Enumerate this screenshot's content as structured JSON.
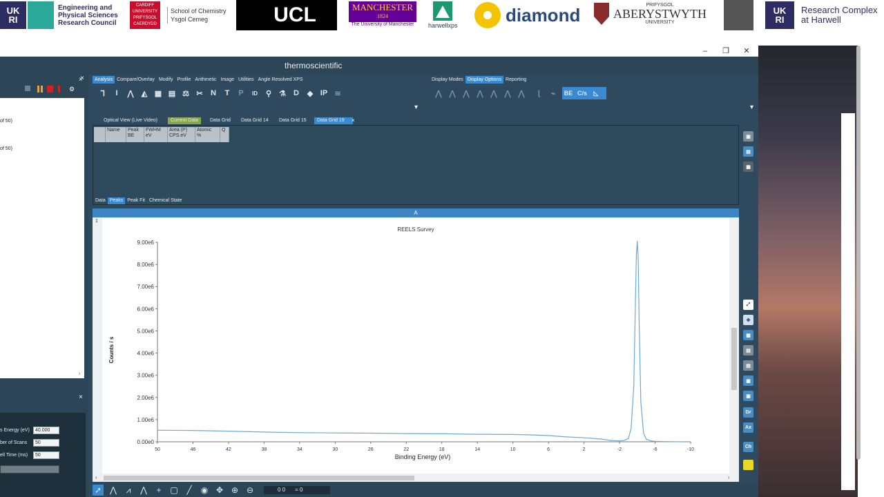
{
  "logos": {
    "ukri": {
      "mark": "UK\nRI",
      "text_lines": [
        "Engineering and",
        "Physical Sciences",
        "Research Council"
      ]
    },
    "cardiff": {
      "mark_lines": [
        "CARDIFF",
        "UNIVERSITY",
        "PRIFYSGOL",
        "CAERDYDD"
      ],
      "text_lines": [
        "School of Chemistry",
        "Ysgol Cemeg"
      ]
    },
    "ucl": {
      "text": "UCL"
    },
    "manchester": {
      "text": "MANCHESTER",
      "year": "1824",
      "sub": "The University of Manchester"
    },
    "harwellxps": {
      "text": "harwellxps"
    },
    "diamond": {
      "text": "diamond"
    },
    "aberystwyth": {
      "top": "PRIFYSGOL",
      "text": "ABERYSTWYTH",
      "sub": "UNIVERSITY"
    },
    "research_complex": {
      "mark": "UK\nRI",
      "text_lines": [
        "Research Complex",
        "at Harwell"
      ]
    }
  },
  "window": {
    "brand": "thermoscientific",
    "minimize": "–",
    "maximize": "❐",
    "close": "✕"
  },
  "ribbon": {
    "tabs": [
      "Analysis",
      "Compare/Overlay",
      "Modify",
      "Profile",
      "Arithmetic",
      "Image",
      "Utilities",
      "Angle Resolved XPS"
    ],
    "right_tabs": [
      "Display Modes",
      "Display Options",
      "Reporting"
    ],
    "icons": [
      "ID",
      "D",
      "IP"
    ],
    "toggles": [
      "BE",
      "C/s"
    ]
  },
  "left_panel": {
    "items": [
      "of 50)",
      "of 50)"
    ],
    "fields": [
      {
        "label": "s Energy (eV)",
        "value": "40.000"
      },
      {
        "label": "ber of Scans",
        "value": "50"
      },
      {
        "label": "ell Time  (ms)",
        "value": "50"
      }
    ]
  },
  "doc_tabs": [
    "Optical View (Live Video)",
    "Current Data",
    "Data Grid",
    "Data Grid 14",
    "Data Grid 15",
    "Data Grid 19"
  ],
  "grid": {
    "columns": [
      {
        "l1": "",
        "l2": ""
      },
      {
        "l1": "Name",
        "l2": ""
      },
      {
        "l1": "Peak",
        "l2": "BE"
      },
      {
        "l1": "FWHM",
        "l2": "eV"
      },
      {
        "l1": "Area (P)",
        "l2": "CPS.eV"
      },
      {
        "l1": "Atomic",
        "l2": "%"
      },
      {
        "l1": "Q",
        "l2": ""
      }
    ],
    "bottom_tabs": [
      "Data",
      "Peaks",
      "Peak Fit",
      "Chemical State"
    ]
  },
  "chart_panel": {
    "header": "A",
    "side_label": "1"
  },
  "chart_data": {
    "type": "line",
    "title": "REELS Survey",
    "xlabel": "Binding Energy (eV)",
    "ylabel": "Counts / s",
    "xlim": [
      50,
      -10
    ],
    "ylim": [
      0,
      9000000
    ],
    "x_ticks": [
      50,
      46,
      42,
      38,
      34,
      30,
      26,
      22,
      18,
      14,
      10,
      6,
      2,
      -2,
      -6,
      -10
    ],
    "x_tick_labels": [
      "50",
      "46",
      "42",
      "38",
      "34",
      "30",
      "26",
      "22",
      "18",
      "14",
      "10",
      "6",
      "2",
      "-2",
      "-6",
      "-10"
    ],
    "y_ticks": [
      0,
      1000000,
      2000000,
      3000000,
      4000000,
      5000000,
      6000000,
      7000000,
      8000000,
      9000000
    ],
    "y_tick_labels": [
      "0.00e0",
      "1.00e6",
      "2.00e6",
      "3.00e6",
      "4.00e6",
      "5.00e6",
      "6.00e6",
      "7.00e6",
      "8.00e6",
      "9.00e6"
    ],
    "series": [
      {
        "color": "#6aa8d8",
        "x": [
          50,
          46,
          42,
          38,
          34,
          30,
          26,
          22,
          18,
          14,
          10,
          8,
          6,
          4,
          2,
          0,
          -1,
          -2,
          -2.5,
          -3,
          -3.3,
          -3.6,
          -3.8,
          -3.9,
          -4,
          -4.1,
          -4.2,
          -4.4,
          -4.7,
          -5,
          -5.5,
          -6,
          -7,
          -8,
          -9
        ],
        "values": [
          520000,
          510000,
          480000,
          440000,
          410000,
          400000,
          390000,
          370000,
          360000,
          340000,
          330000,
          310000,
          280000,
          220000,
          180000,
          120000,
          60000,
          40000,
          60000,
          150000,
          600000,
          2500000,
          6500000,
          8500000,
          9050000,
          8200000,
          5500000,
          1800000,
          400000,
          120000,
          40000,
          20000,
          10000,
          5000,
          0
        ]
      }
    ]
  },
  "bottom_toolbar": {
    "coord_a": "0   0",
    "coord_b": "= 0"
  },
  "right_icons": [
    "Gr",
    "Ax",
    "Ch"
  ]
}
